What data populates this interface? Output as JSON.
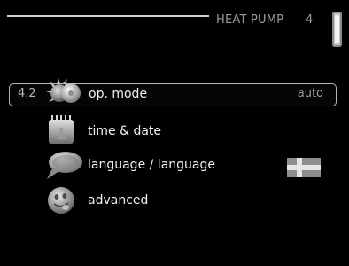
{
  "header": {
    "title": "HEAT PUMP",
    "menu_number": "4"
  },
  "menu": {
    "items": [
      {
        "code": "4.2",
        "label": "op. mode",
        "value": "auto",
        "icon": "sun-gear-icon",
        "selected": true
      },
      {
        "code": "",
        "label": "time & date",
        "value": "",
        "icon": "calendar-icon",
        "selected": false
      },
      {
        "code": "",
        "label": "language / language",
        "value": "",
        "icon": "speech-bubble-icon",
        "selected": false
      },
      {
        "code": "",
        "label": "advanced",
        "value": "",
        "icon": "tongue-face-icon",
        "selected": false
      }
    ],
    "language_flag": "swedish-flag-icon",
    "language_flag_colors": {
      "field": "#8d8d8d",
      "cross": "#e6e6e6"
    }
  }
}
